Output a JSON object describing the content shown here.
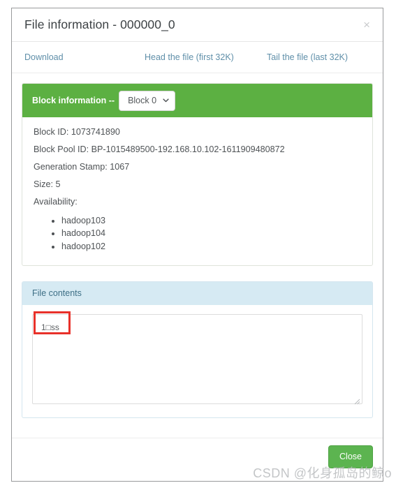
{
  "dialog": {
    "title": "File information - 000000_0",
    "close_icon": "close-icon",
    "close_icon_glyph": "×"
  },
  "links": {
    "download": "Download",
    "head": "Head the file (first 32K)",
    "tail": "Tail the file (last 32K)"
  },
  "block_panel": {
    "title": "Block information --",
    "accent_color": "#5cb042",
    "select": {
      "selected": "Block 0",
      "options": [
        "Block 0"
      ],
      "chevron_icon": "chevron-down-icon"
    },
    "lines": [
      "Block ID: 1073741890",
      "Block Pool ID: BP-1015489500-192.168.10.102-1611909480872",
      "Generation Stamp: 1067",
      "Size: 5",
      "Availability:"
    ],
    "block_id": "1073741890",
    "block_pool_id": "BP-1015489500-192.168.10.102-1611909480872",
    "generation_stamp": "1067",
    "size": "5",
    "availability": [
      "hadoop103",
      "hadoop104",
      "hadoop102"
    ]
  },
  "contents_panel": {
    "title": "File contents",
    "accent_color": "#d6eaf3",
    "textarea_value": "1□ss",
    "textarea_placeholder": "",
    "annotation_color": "#e8312a"
  },
  "footer": {
    "close_label": "Close",
    "close_color": "#5cb450"
  },
  "watermark": {
    "text": "CSDN @化身孤岛的鲸o"
  }
}
